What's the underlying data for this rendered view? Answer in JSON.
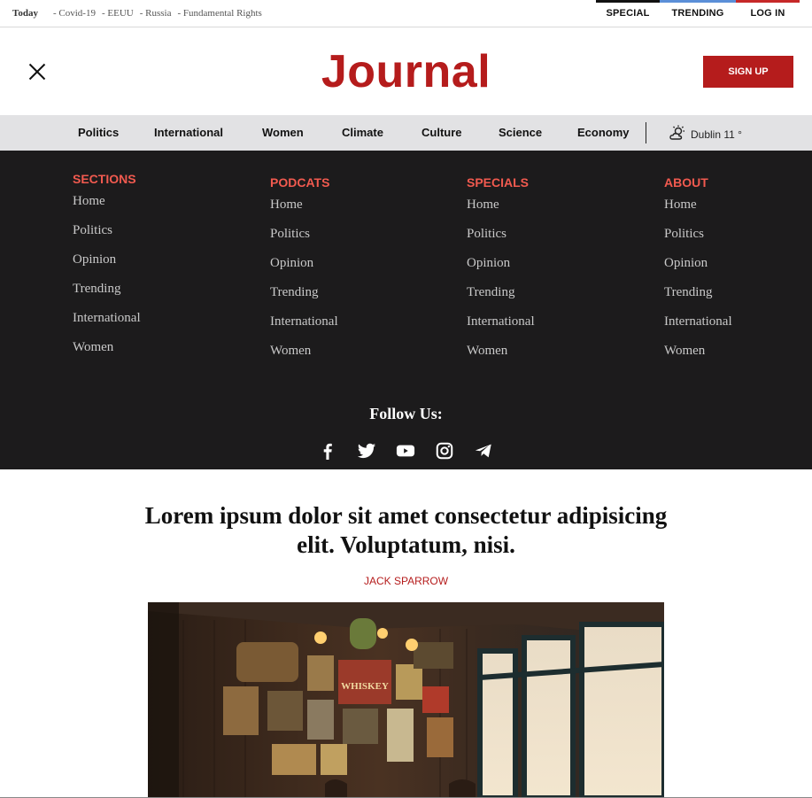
{
  "topbar": {
    "today": "Today",
    "topics": [
      "- Covid-19",
      "- EEUU",
      "- Russia",
      "- Fundamental Rights"
    ],
    "links": [
      {
        "label": "SPECIAL",
        "color": "#111111"
      },
      {
        "label": "TRENDING",
        "color": "#5b8fd8"
      },
      {
        "label": "LOG IN",
        "color": "#c62828"
      }
    ]
  },
  "header": {
    "logo": "Journal",
    "signup_label": "SIGN UP"
  },
  "nav": {
    "items": [
      "Politics",
      "International",
      "Women",
      "Climate",
      "Culture",
      "Science",
      "Economy"
    ],
    "weather": "Dublin 11 °"
  },
  "menu": {
    "columns": [
      {
        "title": "SECTIONS",
        "items": [
          "Home",
          "Politics",
          "Opinion",
          "Trending",
          "International",
          "Women"
        ]
      },
      {
        "title": "PODCATS",
        "items": [
          "Home",
          "Politics",
          "Opinion",
          "Trending",
          "International",
          "Women"
        ]
      },
      {
        "title": "SPECIALS",
        "items": [
          "Home",
          "Politics",
          "Opinion",
          "Trending",
          "International",
          "Women"
        ]
      },
      {
        "title": "ABOUT",
        "items": [
          "Home",
          "Politics",
          "Opinion",
          "Trending",
          "International",
          "Women"
        ]
      }
    ],
    "follow": "Follow Us:",
    "social": [
      "facebook-icon",
      "twitter-icon",
      "youtube-icon",
      "instagram-icon",
      "telegram-icon"
    ]
  },
  "article": {
    "headline": "Lorem ipsum dolor sit amet consectetur adipisicing elit. Voluptatum, nisi.",
    "author": "JACK SPARROW"
  },
  "colors": {
    "brand_red": "#b51c1c",
    "menu_bg": "#1c1b1c",
    "menu_title": "#f15a4f",
    "nav_bg": "#e2e2e4"
  }
}
